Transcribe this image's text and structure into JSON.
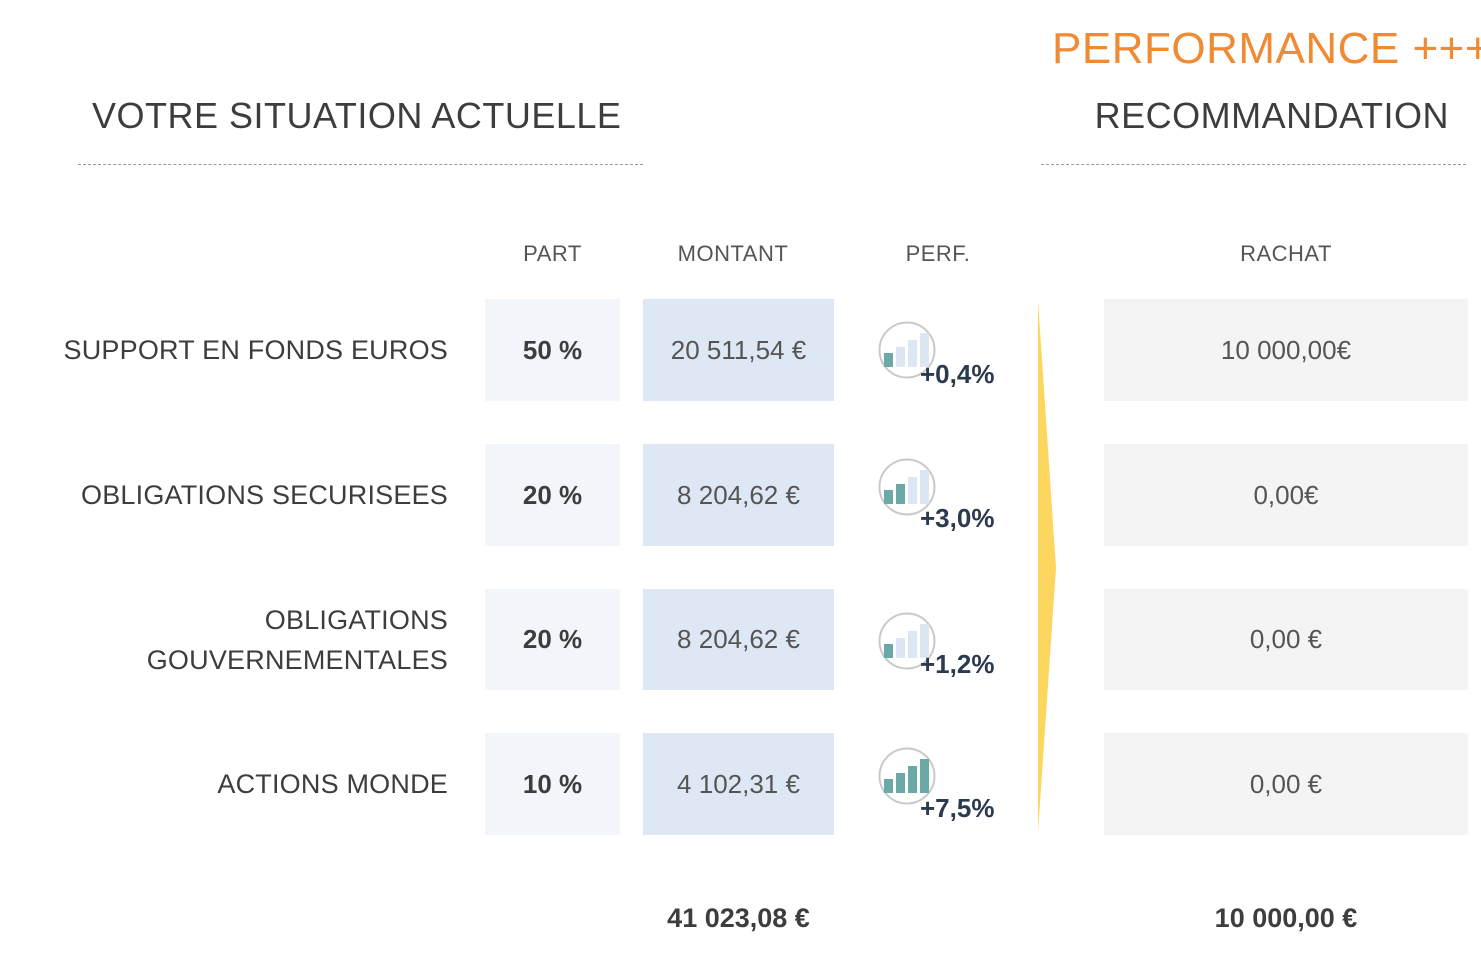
{
  "header": {
    "left_title": "VOTRE SITUATION ACTUELLE",
    "right_title": "RECOMMANDATION",
    "badge": "PERFORMANCE +++"
  },
  "columns": {
    "part": "PART",
    "montant": "MONTANT",
    "perf": "PERF.",
    "rachat": "RACHAT"
  },
  "rows": [
    {
      "label_line1": "SUPPORT EN FONDS EUROS",
      "label_line2": "",
      "part": "50 %",
      "montant": "20 511,54 €",
      "perf": "+0,4%",
      "perf_level": 1,
      "rachat": "10 000,00€"
    },
    {
      "label_line1": "OBLIGATIONS SECURISEES",
      "label_line2": "",
      "part": "20 %",
      "montant": "8 204,62 €",
      "perf": "+3,0%",
      "perf_level": 2,
      "rachat": "0,00€"
    },
    {
      "label_line1": "OBLIGATIONS",
      "label_line2": "GOUVERNEMENTALES",
      "part": "20 %",
      "montant": "8 204,62 €",
      "perf": "+1,2%",
      "perf_level": 1,
      "rachat": "0,00 €"
    },
    {
      "label_line1": "ACTIONS MONDE",
      "label_line2": "",
      "part": "10 %",
      "montant": "4 102,31 €",
      "perf": "+7,5%",
      "perf_level": 4,
      "rachat": "0,00 €"
    }
  ],
  "totals": {
    "montant": "41 023,08 €",
    "rachat": "10 000,00 €"
  },
  "colors": {
    "accent": "#f08a33",
    "arrow": "#fdd660",
    "bar_active": "#6aa9a5",
    "bar_inactive": "#dce7f3"
  },
  "icons": {
    "perf": "bar-chart-icon",
    "separator": "chevron-right-arrow"
  }
}
